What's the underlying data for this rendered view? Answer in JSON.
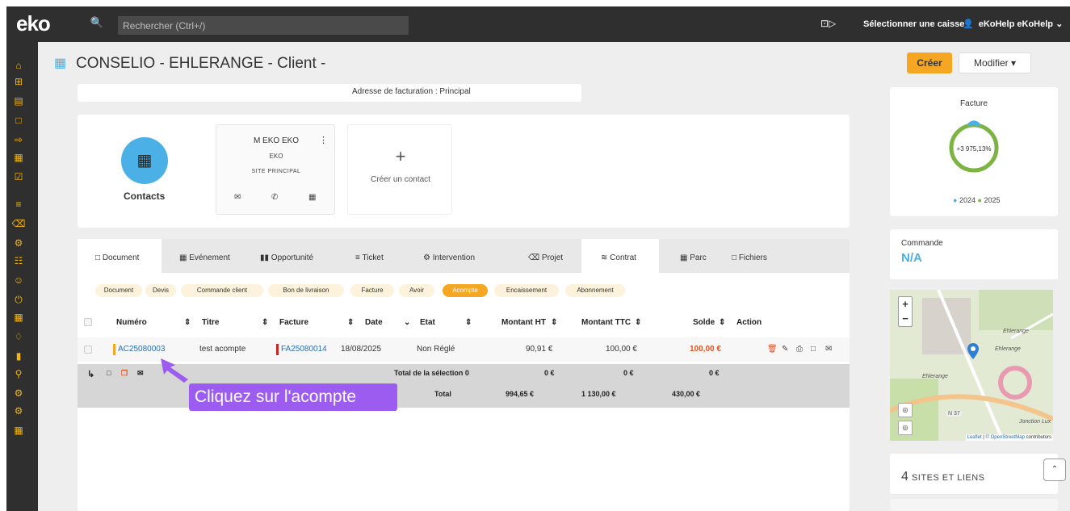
{
  "app": {
    "logo": "eko"
  },
  "topbar": {
    "search_placeholder": "Rechercher (Ctrl+/)",
    "caisse_label": "Sélectionner une caisse",
    "user_label": "eKoHelp eKoHelp"
  },
  "page": {
    "title": "CONSELIO - EHLERANGE - Client -",
    "create_label": "Créer",
    "modify_label": "Modifier"
  },
  "info": {
    "billing_address": "Adresse de facturation : Principal"
  },
  "contacts": {
    "label": "Contacts",
    "card": {
      "name": "M EKO EKO",
      "company": "EKO",
      "site": "SITE PRINCIPAL"
    },
    "new_label": "Créer un contact"
  },
  "tabs": [
    "Document",
    "Evénement",
    "Opportunité",
    "Ticket",
    "Intervention",
    "Projet",
    "Contrat",
    "Parc",
    "Fichiers"
  ],
  "chips": [
    "Document",
    "Devis",
    "Commande client",
    "Bon de livraison",
    "Facture",
    "Avoir",
    "Acompte",
    "Encaissement",
    "Abonnement"
  ],
  "table": {
    "headers": [
      "Numéro",
      "Titre",
      "Facture",
      "Date",
      "Etat",
      "Montant HT",
      "Montant TTC",
      "Solde",
      "Action"
    ],
    "row": {
      "numero": "AC25080003",
      "titre": "test acompte",
      "facture": "FA25080014",
      "date": "18/08/2025",
      "etat": "Non Réglé",
      "montant_ht": "90,91 €",
      "montant_ttc": "100,00 €",
      "solde": "100,00 €"
    },
    "selection_total": {
      "label": "Total de la sélection 0",
      "ht": "0 €",
      "ttc": "0 €",
      "solde": "0 €"
    },
    "grand_total": {
      "label": "Total",
      "ht": "994,65 €",
      "ttc": "1 130,00 €",
      "solde": "430,00 €"
    }
  },
  "hint": "Cliquez sur l'acompte",
  "facture_widget": {
    "title": "Facture",
    "center": "+3 975,13%",
    "legend_2024": "2024",
    "legend_2025": "2025",
    "colors": {
      "y2024": "#4ab0e6",
      "y2025": "#7cb342"
    }
  },
  "commande_widget": {
    "title": "Commande",
    "value": "N/A"
  },
  "map": {
    "labels": [
      "Ehlerange",
      "Ehlerange",
      "Ehlerange",
      "N 37",
      "Jonction Lux"
    ],
    "attrib_leaflet": "Leaflet",
    "attrib_osm": "© OpenStreetMap",
    "attrib_rest": " contributors"
  },
  "sites": {
    "count": "4",
    "label": "SITES ET LIENS"
  }
}
